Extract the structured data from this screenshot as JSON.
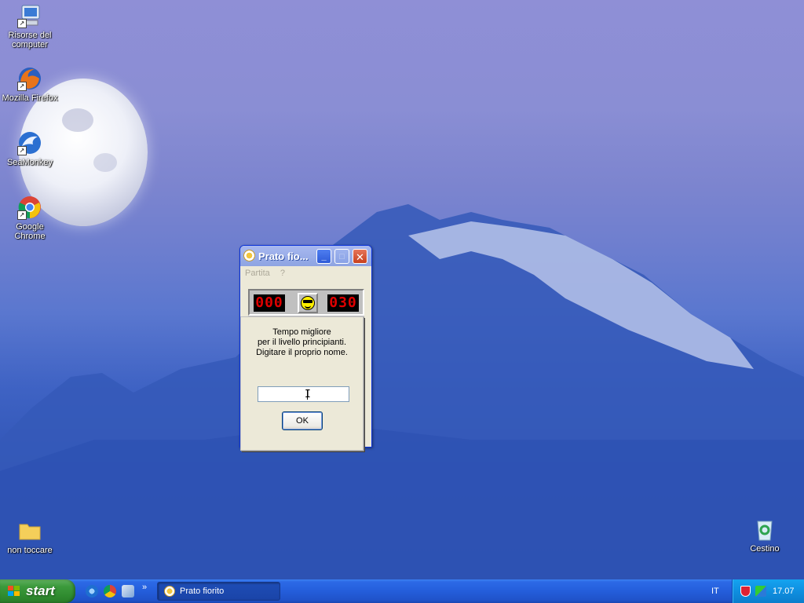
{
  "desktop": {
    "icons": [
      {
        "label_line1": "Risorse del",
        "label_line2": "computer",
        "icon": "my-computer-icon"
      },
      {
        "label": "Mozilla Firefox",
        "icon": "firefox-icon"
      },
      {
        "label": "SeaMonkey",
        "icon": "seamonkey-icon"
      },
      {
        "label": "Google Chrome",
        "icon": "chrome-icon"
      },
      {
        "label": "non toccare",
        "icon": "folder-icon"
      },
      {
        "label": "Cestino",
        "icon": "recycle-bin-icon"
      }
    ]
  },
  "window": {
    "title": "Prato fio...",
    "menu": [
      "Partita",
      "?"
    ],
    "counter_left": "000",
    "counter_right": "030",
    "face_icon": "cool-smiley-icon"
  },
  "dialog": {
    "message_line1": "Tempo migliore",
    "message_line2": "per il livello principianti.",
    "message_line3": "Digitare il proprio nome.",
    "name_value": "",
    "ok_label": "OK"
  },
  "taskbar": {
    "start_label": "start",
    "quick_launch_more": "»",
    "task_button_label": "Prato fiorito",
    "language": "IT",
    "clock": "17.07"
  },
  "colors": {
    "taskbar_blue": "#245edb",
    "start_green": "#3c9a3c",
    "tray_blue": "#0f8fe0",
    "counter_red": "#e00000"
  }
}
